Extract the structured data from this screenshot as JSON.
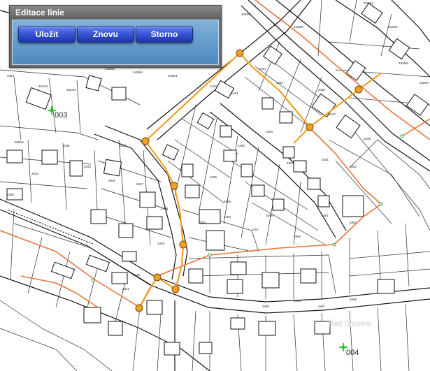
{
  "panel": {
    "title": "Editace linie",
    "buttons": {
      "save": "Uložit",
      "redo": "Znovu",
      "cancel": "Storno"
    }
  },
  "map": {
    "points": [
      {
        "label": "003"
      },
      {
        "label": "004"
      }
    ],
    "colors": {
      "edited_line": "#f2a024",
      "network_line": "#e8743b",
      "point_marker": "#19c419"
    },
    "watermark": "Řeč Šmorno",
    "parcel_numbers": [
      "3420/3",
      "3420/2",
      "3426/1",
      "3426/2",
      "3426/5",
      "3426/6",
      "3426/7",
      "3429",
      "3424/3",
      "3424/4",
      "3425/5",
      "3425/8",
      "3430/1",
      "3430/2",
      "3430/4",
      "3431",
      "3432",
      "3433",
      "3434",
      "3435",
      "3436",
      "3437",
      "3438",
      "3439",
      "3440",
      "3441",
      "3442",
      "3443",
      "3444",
      "3445",
      "3446",
      "3447",
      "3448",
      "3450",
      "3451",
      "3452",
      "3453",
      "3454",
      "3455",
      "3456",
      "3457",
      "3458",
      "3460",
      "3461",
      "3462",
      "3463",
      "3464",
      "3465",
      "3466",
      "3467",
      "3468"
    ]
  }
}
